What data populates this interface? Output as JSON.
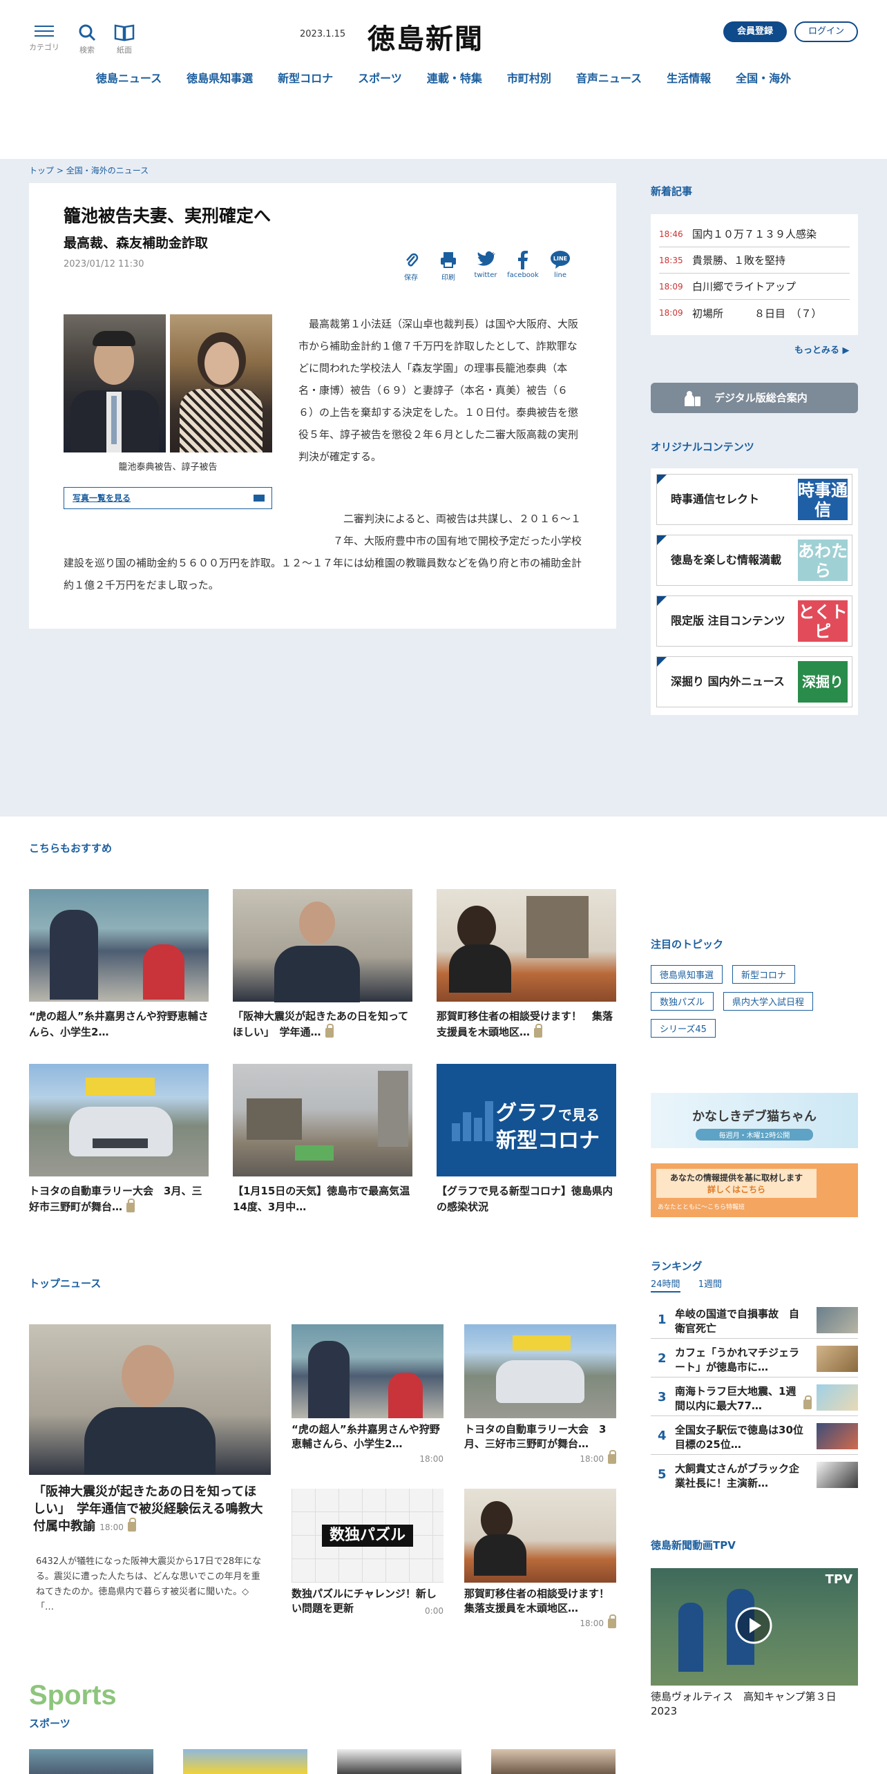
{
  "header": {
    "date": "2023.1.15",
    "logo": "徳島新聞",
    "icons": [
      {
        "name": "menu-icon",
        "label": "カテゴリ"
      },
      {
        "name": "search-icon",
        "label": "検索"
      },
      {
        "name": "book-icon",
        "label": "紙面"
      }
    ],
    "member_button": "会員登録",
    "login_button": "ログイン",
    "nav": [
      "徳島ニュース",
      "徳島県知事選",
      "新型コロナ",
      "スポーツ",
      "連載・特集",
      "市町村別",
      "音声ニュース",
      "生活情報",
      "全国・海外"
    ]
  },
  "breadcrumb": {
    "home": "トップ",
    "sep": ">",
    "current": "全国・海外のニュース"
  },
  "article": {
    "title": "籠池被告夫妻、実刑確定へ",
    "subtitle": "最高裁、森友補助金詐取",
    "date": "2023/01/12 11:30",
    "share": [
      {
        "name": "save",
        "label": "保存"
      },
      {
        "name": "print",
        "label": "印刷"
      },
      {
        "name": "twitter",
        "label": "twitter"
      },
      {
        "name": "facebook",
        "label": "facebook"
      },
      {
        "name": "line",
        "label": "line"
      }
    ],
    "photo_caption": "籠池泰典被告、諄子被告",
    "photo_list_link": "写真一覧を見る",
    "paragraph1": "最高裁第１小法廷（深山卓也裁判長）は国や大阪府、大阪市から補助金計約１億７千万円を詐取したとして、詐欺罪などに問われた学校法人「森友学園」の理事長籠池泰典（本名・康博）被告（６９）と妻諄子（本名・真美）被告（６６）の上告を棄却する決定をした。１０日付。泰典被告を懲役５年、諄子被告を懲役２年６月とした二審大阪高裁の実刑判決が確定する。",
    "paragraph2": "二審判決によると、両被告は共謀し、２０１６～１７年、大阪府豊中市の国有地で開校予定だった小学校建設を巡り国の補助金約５６００万円を詐取。１２～１７年には幼稚園の教職員数などを偽り府と市の補助金計約１億２千万円をだまし取った。"
  },
  "sidebar": {
    "new_title": "新着記事",
    "new_items": [
      {
        "time": "18:46",
        "text": "国内１０万７１３９人感染"
      },
      {
        "time": "18:35",
        "text": "貴景勝、１敗を堅持"
      },
      {
        "time": "18:09",
        "text": "白川郷でライトアップ"
      },
      {
        "time": "18:09",
        "text": "初場所　　　８日目　（７）"
      }
    ],
    "more": "もっとみる ▶",
    "digital": "デジタル版総合案内",
    "original_title": "オリジナルコンテンツ",
    "original": [
      {
        "title": "時事通信セレクト",
        "badge": "時事通信",
        "color": "#1f5fa6"
      },
      {
        "title": "徳島を楽しむ情報満載",
        "badge": "あわたら",
        "color": "#9fd0d4"
      },
      {
        "title": "限定版 注目コンテンツ",
        "badge": "とくトピ",
        "color": "#e24c5a"
      },
      {
        "title": "深掘り 国内外ニュース",
        "badge": "深掘り",
        "color": "#2a8c4a"
      }
    ]
  },
  "recommend": {
    "title": "こちらもおすすめ",
    "items": [
      {
        "text": "“虎の超人”糸井嘉男さんや狩野恵輔さんら、小学生2…",
        "lock": false
      },
      {
        "text": "「阪神大震災が起きたあの日を知ってほしい」　学年通…",
        "lock": true
      },
      {
        "text": "那賀町移住者の相談受けます！　集落支援員を木頭地区…",
        "lock": true
      },
      {
        "text": "トヨタの自動車ラリー大会　3月、三好市三野町が舞台…",
        "lock": true
      },
      {
        "text": "【1月15日の天気】徳島市で最高気温14度、3月中…",
        "lock": false
      },
      {
        "text": "【グラフで見る新型コロナ】徳島県内の感染状況",
        "lock": false
      }
    ],
    "graph_banner": {
      "line1a": "グラフ",
      "line1b": "で見る",
      "line2": "新型コロナ"
    }
  },
  "topics": {
    "title": "注目のトピック",
    "tags": [
      "徳島県知事選",
      "新型コロナ",
      "数独パズル",
      "県内大学入試日程",
      "シリーズ45"
    ]
  },
  "banners": {
    "cat_title": "かなしきデブ猫ちゃん",
    "cat_sub": "毎週月・木曜12時公開",
    "info_line1": "あなたの情報提供を基に取材します",
    "info_line2": "詳しくはこちら",
    "info_line3": "あなたとともに～こちら特報班"
  },
  "top_news": {
    "title": "トップニュース",
    "main": {
      "text": "「阪神大震災が起きたあの日を知ってほしい」　学年通信で被災経験伝える鳴教大付属中教諭",
      "time": "18:00",
      "summary": "6432人が犠牲になった阪神大震災から17日で28年になる。震災に遭った人たちは、どんな思いでこの年月を重ねてきたのか。徳島県内で暮らす被災者に聞いた。◇　「…"
    },
    "items": [
      {
        "text": "“虎の超人”糸井嘉男さんや狩野恵輔さんら、小学生2…",
        "time": "18:00",
        "lock": false
      },
      {
        "text": "トヨタの自動車ラリー大会　3月、三好市三野町が舞台…",
        "time": "18:00",
        "lock": true
      },
      {
        "text": "数独パズルにチャレンジ！新しい問題を更新",
        "time": "0:00",
        "lock": false
      },
      {
        "text": "那賀町移住者の相談受けます！　集落支援員を木頭地区…",
        "time": "18:00",
        "lock": true
      }
    ],
    "sudoku_label": "数独パズル"
  },
  "ranking": {
    "title": "ランキング",
    "tab_active": "24時間",
    "tab_other": "1週間",
    "items": [
      {
        "rank": "1",
        "text": "牟岐の国道で自損事故　自衛官死亡",
        "lock": false
      },
      {
        "rank": "2",
        "text": "カフェ「うかれマチジェラート」が徳島市に…",
        "lock": false
      },
      {
        "rank": "3",
        "text": "南海トラフ巨大地震、1週間以内に最大77…",
        "lock": true
      },
      {
        "rank": "4",
        "text": "全国女子駅伝で徳島は30位　目標の25位…",
        "lock": false
      },
      {
        "rank": "5",
        "text": "大飼貴丈さんがブラック企業社長に！主演新…",
        "lock": false
      }
    ]
  },
  "tpv": {
    "title": "徳島新聞動画TPV",
    "caption": "徳島ヴォルティス　高知キャンプ第３日　2023",
    "badge": "TPV"
  },
  "sports": {
    "title": "Sports",
    "sub": "スポーツ"
  }
}
